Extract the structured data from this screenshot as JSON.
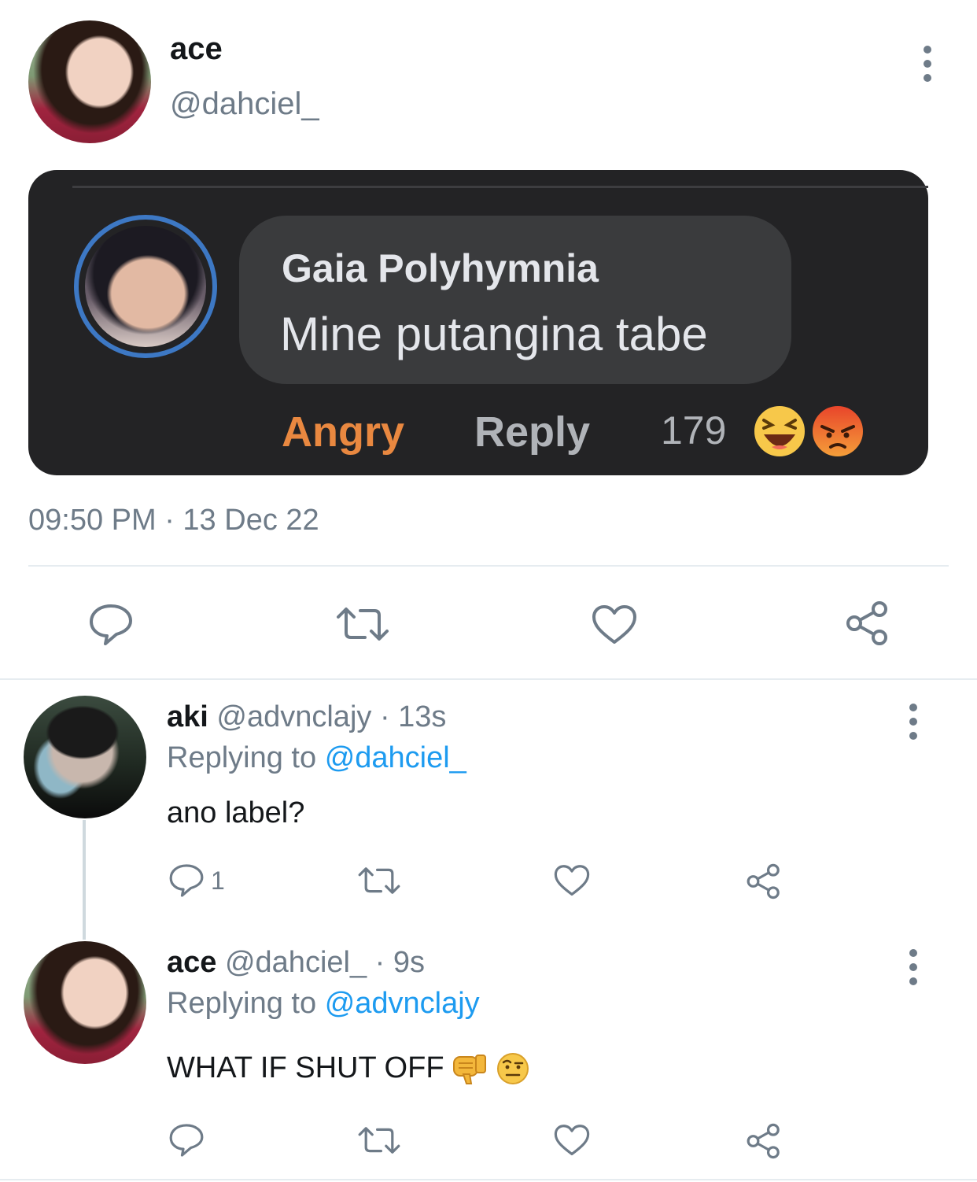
{
  "main_tweet": {
    "display_name": "ace",
    "handle": "@dahciel_",
    "timestamp": "09:50 PM · 13 Dec 22",
    "embedded_comment": {
      "author": "Gaia Polyhymnia",
      "text": "Mine putangina tabe",
      "reaction_label": "Angry",
      "reply_label": "Reply",
      "reaction_count": "179",
      "reaction_icons": [
        "haha-emoji-icon",
        "angry-emoji-icon"
      ]
    }
  },
  "replies": [
    {
      "display_name": "aki",
      "handle": "@advnclajy",
      "time": "· 13s",
      "replying_prefix": "Replying to",
      "replying_to": "@dahciel_",
      "text": "ano label?",
      "reply_count": "1"
    },
    {
      "display_name": "ace",
      "handle": "@dahciel_",
      "time": "· 9s",
      "replying_prefix": "Replying to",
      "replying_to": "@advnclajy",
      "text": "WHAT IF SHUT OFF",
      "emojis": [
        "thumbs-down-icon",
        "raised-eyebrow-face-icon"
      ]
    }
  ],
  "colors": {
    "link": "#1d9bf0",
    "muted": "#6e7b88",
    "card_bg": "#232325",
    "angry_orange": "#e98840"
  }
}
